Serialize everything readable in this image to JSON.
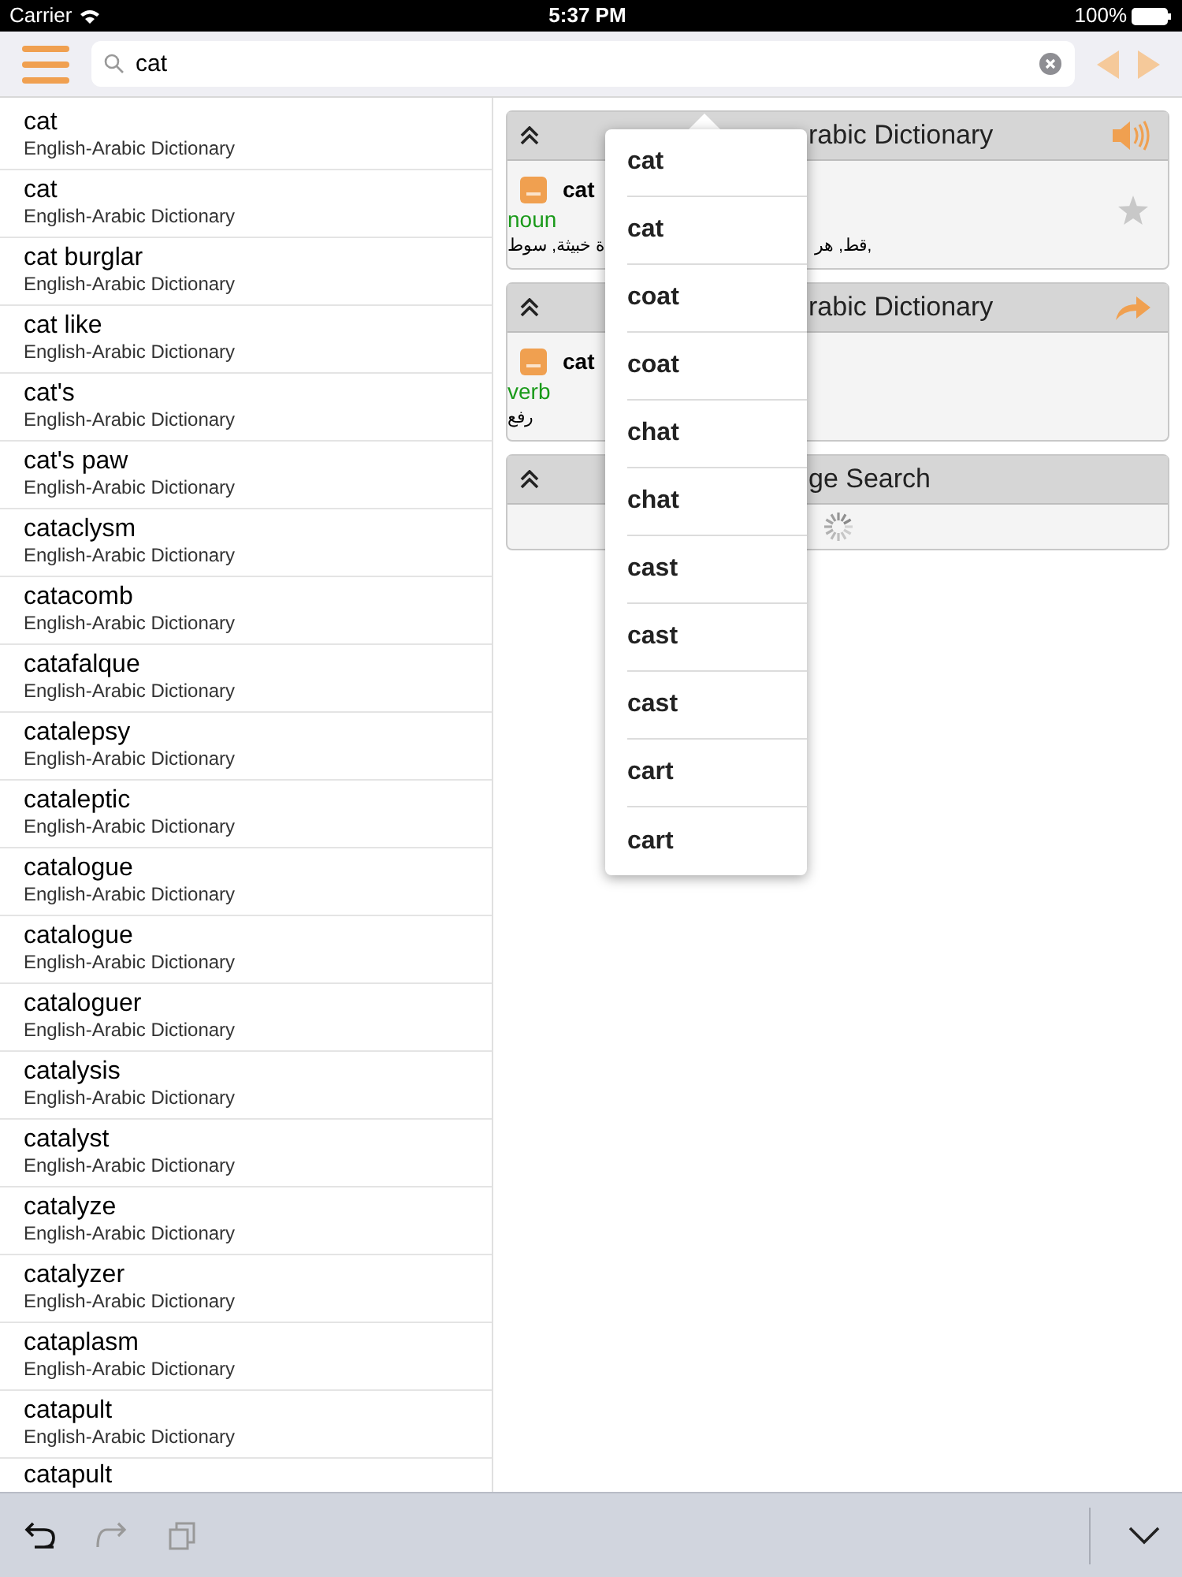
{
  "status_bar": {
    "carrier": "Carrier",
    "time": "5:37 PM",
    "battery": "100%"
  },
  "search": {
    "value": "cat"
  },
  "results": [
    {
      "word": "cat",
      "source": "English-Arabic Dictionary"
    },
    {
      "word": "cat",
      "source": "English-Arabic Dictionary"
    },
    {
      "word": "cat burglar",
      "source": "English-Arabic Dictionary"
    },
    {
      "word": "cat like",
      "source": "English-Arabic Dictionary"
    },
    {
      "word": "cat's",
      "source": "English-Arabic Dictionary"
    },
    {
      "word": "cat's paw",
      "source": "English-Arabic Dictionary"
    },
    {
      "word": "cataclysm",
      "source": "English-Arabic Dictionary"
    },
    {
      "word": "catacomb",
      "source": "English-Arabic Dictionary"
    },
    {
      "word": "catafalque",
      "source": "English-Arabic Dictionary"
    },
    {
      "word": "catalepsy",
      "source": "English-Arabic Dictionary"
    },
    {
      "word": "cataleptic",
      "source": "English-Arabic Dictionary"
    },
    {
      "word": "catalogue",
      "source": "English-Arabic Dictionary"
    },
    {
      "word": "catalogue",
      "source": "English-Arabic Dictionary"
    },
    {
      "word": "cataloguer",
      "source": "English-Arabic Dictionary"
    },
    {
      "word": "catalysis",
      "source": "English-Arabic Dictionary"
    },
    {
      "word": "catalyst",
      "source": "English-Arabic Dictionary"
    },
    {
      "word": "catalyze",
      "source": "English-Arabic Dictionary"
    },
    {
      "word": "catalyzer",
      "source": "English-Arabic Dictionary"
    },
    {
      "word": "cataplasm",
      "source": "English-Arabic Dictionary"
    },
    {
      "word": "catapult",
      "source": "English-Arabic Dictionary"
    },
    {
      "word": "catapult"
    }
  ],
  "sections": [
    {
      "kind": "entry",
      "title": "rabic Dictionary",
      "button": {
        "kind": "speaker"
      },
      "word": "cat",
      "pos": "noun",
      "meaning_left": "ة خبيثة, سوط",
      "meaning_right": "قط, هر,",
      "starred": false
    },
    {
      "kind": "entry",
      "title": "rabic Dictionary",
      "button": {
        "kind": "share"
      },
      "word": "cat",
      "pos": "verb",
      "meaning_left": "رفع"
    },
    {
      "kind": "loading",
      "title": "ge Search"
    }
  ],
  "suggestions": [
    "cat",
    "cat",
    "coat",
    "coat",
    "chat",
    "chat",
    "cast",
    "cast",
    "cast",
    "cart",
    "cart"
  ]
}
